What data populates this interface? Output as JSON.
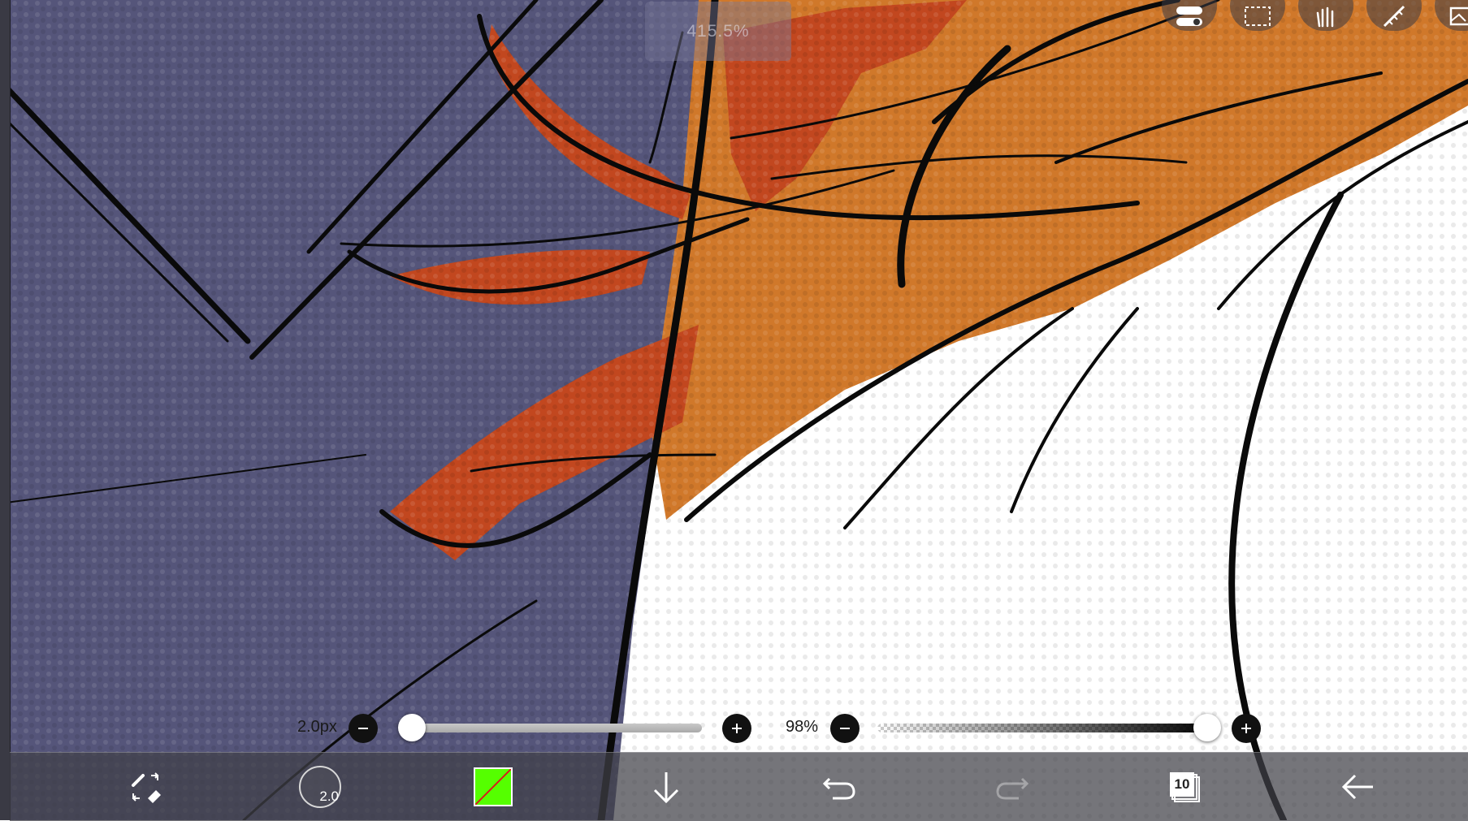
{
  "canvas": {
    "zoom_level": "415.5%"
  },
  "top_tools": [
    {
      "name": "toggle-icon"
    },
    {
      "name": "selection-icon"
    },
    {
      "name": "hand-icon"
    },
    {
      "name": "ruler-icon"
    },
    {
      "name": "material-icon"
    }
  ],
  "brush_size_slider": {
    "value_label": "2.0px",
    "minus_icon": "minus-icon",
    "plus_icon": "plus-icon",
    "fraction": 0.0
  },
  "opacity_slider": {
    "value_label": "98%",
    "minus_icon": "minus-icon",
    "plus_icon": "plus-icon",
    "fraction": 0.98
  },
  "toolbar": {
    "tool_swap_icon": "eraser-swap-icon",
    "brush_size": "2.0",
    "current_color": "#55ff00",
    "download_icon": "arrow-down-icon",
    "undo_icon": "undo-icon",
    "redo_icon": "redo-icon",
    "layer_count": "10",
    "back_icon": "back-arrow-icon"
  },
  "colors": {
    "background_purple": "#55557a",
    "hair_orange": "#d0782a",
    "hair_red": "#c2471f",
    "toolbar_bg": "#5a5a60",
    "ink": "#0a0a0a"
  }
}
